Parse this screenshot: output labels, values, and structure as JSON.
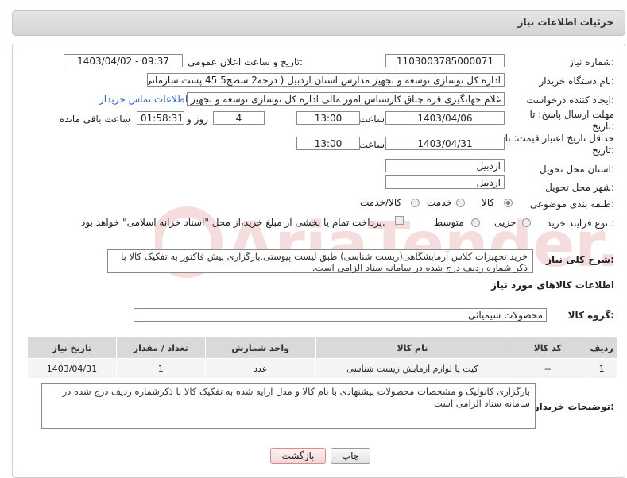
{
  "header": {
    "title": "جزئیات اطلاعات نیاز"
  },
  "fields": {
    "need_number_label": "شماره نیاز:",
    "need_number": "1103003785000071",
    "announce_label": "تاریخ و ساعت اعلان عمومی:",
    "announce_value": "1403/04/02 - 09:37",
    "buyer_label": "نام دستگاه خریدار:",
    "buyer_value": "اداره کل نوسازی   توسعه و تجهیز مدارس استان اردبیل ( درجه2  سطح5  45 پست سازمانی)",
    "creator_label": "ایجاد کننده درخواست:",
    "creator_value": "غلام جهانگیری قره چناق کارشناس امور مالی اداره کل نوسازی   توسعه و تجهیز مدارس استان اردبیل",
    "contact_link": "اطلاعات تماس خریدار",
    "deadline_label": "مهلت ارسال پاسخ: تا تاریخ:",
    "deadline_date": "1403/04/06",
    "time_label": "ساعت",
    "deadline_time": "13:00",
    "days_value": "4",
    "days_label": "روز و",
    "remaining_time": "01:58:31",
    "remaining_label": "ساعت باقی مانده",
    "validity_label": "حداقل تاریخ اعتبار قیمت: تا تاریخ:",
    "validity_date": "1403/04/31",
    "validity_time": "13:00",
    "province_label": "استان محل تحویل:",
    "province_value": "اردبیل",
    "city_label": "شهر محل تحویل:",
    "city_value": "اردبیل",
    "category_label": "طبقه بندی موضوعی:",
    "category_options": [
      "کالا",
      "خدمت",
      "کالا/خدمت"
    ],
    "process_label": "نوع فرآیند خرید :",
    "process_options": [
      "جزیی",
      "متوسط"
    ],
    "process_note": "پرداخت تمام یا بخشی از مبلغ خرید،از محل \"اسناد خزانه اسلامی\" خواهد بود."
  },
  "description": {
    "label": "شرح کلی نیاز:",
    "text": "خرید تجهیزات کلاس آزمایشگاهی(زیست شناسی) طبق لیست پیوستی.بارگزاری پیش فاکتور به تفکیک کالا با ذکر شماره ردیف درج شده در سامانه ستاد الزامی است."
  },
  "items_section": {
    "title": "اطلاعات کالاهای مورد نیاز",
    "group_label": "گروه کالا:",
    "group_value": "محصولات شیمیائی",
    "columns": [
      "ردیف",
      "کد کالا",
      "نام کالا",
      "واحد شمارش",
      "تعداد / مقدار",
      "تاریخ نیاز"
    ],
    "rows": [
      {
        "row": "1",
        "code": "--",
        "name": "کیت یا لوازم آزمایش زیست شناسی",
        "unit": "عدد",
        "qty": "1",
        "date": "1403/04/31"
      }
    ]
  },
  "buyer_notes": {
    "label": "توضیحات خریدار:",
    "text": "بارگزاری کاتولیک و مشخصات محصولات پیشنهادی با نام کالا و مدل ارایه شده به تفکیک کالا با ذکرشماره ردیف درج شده در سامانه ستاد الزامی است"
  },
  "buttons": {
    "print": "چاپ",
    "back": "بازگشت"
  },
  "watermark_text": "AriaTender.neT"
}
